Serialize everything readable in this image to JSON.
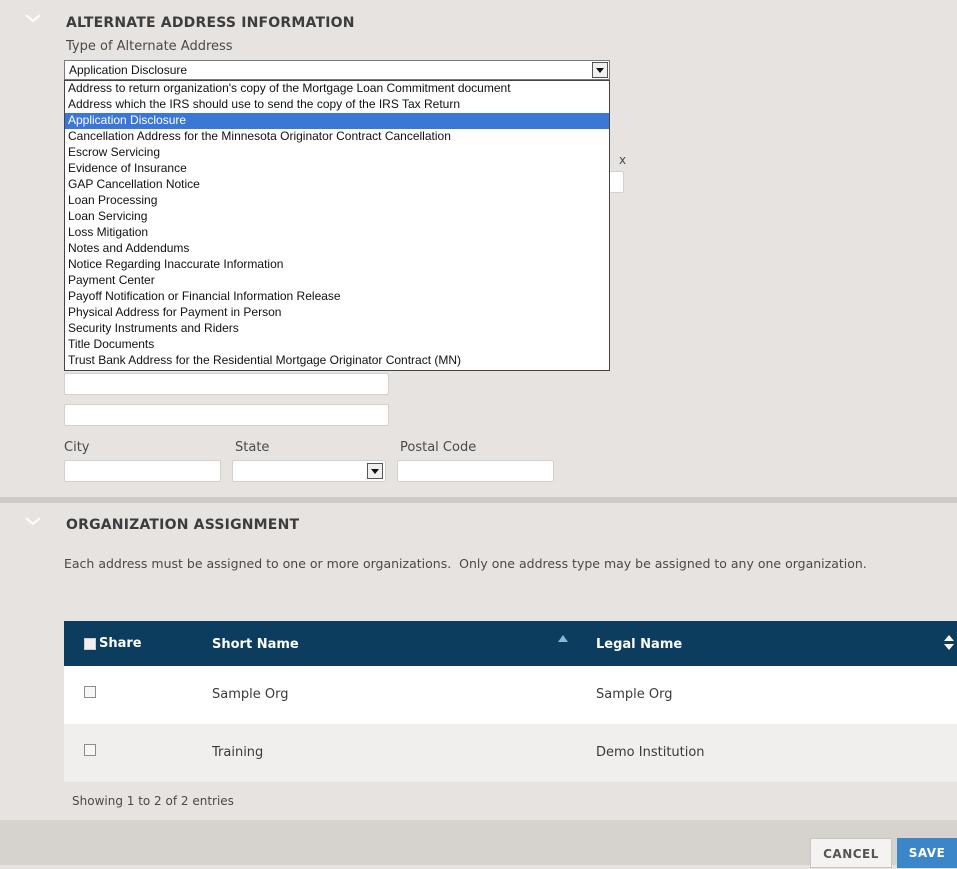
{
  "alternate_address": {
    "section_title": "ALTERNATE ADDRESS INFORMATION",
    "type_label": "Type of Alternate Address",
    "selected_value": "Application Disclosure",
    "options": [
      "Address to return organization's copy of the Mortgage Loan Commitment document",
      "Address which the IRS should use to send the copy of the IRS Tax Return",
      "Application Disclosure",
      "Cancellation Address for the Minnesota Originator Contract Cancellation",
      "Escrow Servicing",
      "Evidence of Insurance",
      "GAP Cancellation Notice",
      "Loan Processing",
      "Loan Servicing",
      "Loss Mitigation",
      "Notes and Addendums",
      "Notice Regarding Inaccurate Information",
      "Payment Center",
      "Payoff Notification or Financial Information Release",
      "Physical Address for Payment in Person",
      "Security Instruments and Riders",
      "Title Documents",
      "Trust Bank Address for the Residential Mortgage Originator Contract (MN)"
    ],
    "selected_index": 2,
    "hidden_label_fragment": "x",
    "city_label": "City",
    "state_label": "State",
    "postal_code_label": "Postal Code"
  },
  "organization_assignment": {
    "section_title": "ORGANIZATION ASSIGNMENT",
    "description": "Each address must be assigned to one or more organizations.  Only one address type may be assigned to any one organization.",
    "columns": {
      "share": "Share",
      "short_name": "Short Name",
      "legal_name": "Legal Name"
    },
    "rows": [
      {
        "short_name": "Sample Org",
        "legal_name": "Sample Org",
        "checked": false
      },
      {
        "short_name": "Training",
        "legal_name": "Demo Institution",
        "checked": false
      }
    ],
    "footer": "Showing 1 to 2 of 2 entries"
  },
  "actions": {
    "cancel_label": "CANCEL",
    "save_label": "SAVE"
  },
  "colors": {
    "header_bg": "#0c3d5f",
    "save_bg": "#3a86c8",
    "selected_option_bg": "#3b78d6"
  },
  "icons": {
    "section_toggle": "chevron-down-icon",
    "sort": "sort-icon",
    "dropdown": "triangle-down-icon"
  }
}
